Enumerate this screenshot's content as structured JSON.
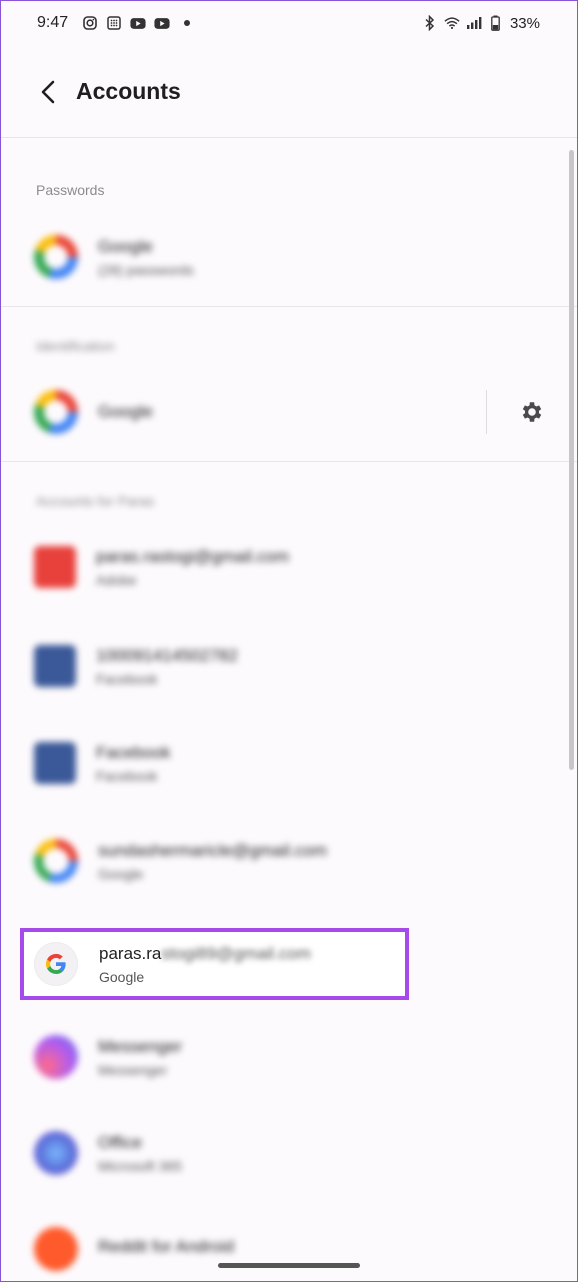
{
  "status_bar": {
    "time": "9:47",
    "battery": "33%",
    "left_icons": [
      "instagram-icon",
      "app-grid-icon",
      "youtube-icon",
      "youtube-icon"
    ],
    "right_icons": [
      "bluetooth-icon",
      "wifi-icon",
      "signal-icon",
      "battery-icon"
    ]
  },
  "app_bar": {
    "title": "Accounts"
  },
  "sections": {
    "passwords_label": "Passwords",
    "passwords_title": "Google",
    "passwords_sub": "(28) passwords",
    "identification_label": "Identification",
    "identification_title": "Google",
    "accounts_label": "Accounts for Paras"
  },
  "accounts": [
    {
      "title": "paras.rastogi@gmail.com",
      "sub": "Adobe",
      "avatar_color": "#e8413c"
    },
    {
      "title": "100091414502782",
      "sub": "Facebook",
      "avatar_color": "#3b5998"
    },
    {
      "title": "Facebook",
      "sub": "Facebook",
      "avatar_color": "#3b5998"
    },
    {
      "title": "sundashermaricle@gmail.com",
      "sub": "Google",
      "avatar_color": "#eaeaea"
    }
  ],
  "highlighted": {
    "email_visible": "paras.ra",
    "email_blurred": "stogi89@gmail.com",
    "sub": "Google"
  },
  "accounts_after": [
    {
      "title": "Messenger",
      "sub": "Messenger",
      "avatar_color": "#b15cf0"
    },
    {
      "title": "Office",
      "sub": "Microsoft 365",
      "avatar_color": "#5a6fd8"
    },
    {
      "title": "Reddit for Android",
      "sub": "",
      "avatar_color": "#ff5a2b"
    }
  ],
  "colors": {
    "highlight": "#a64bea",
    "background": "#fdfafd"
  }
}
